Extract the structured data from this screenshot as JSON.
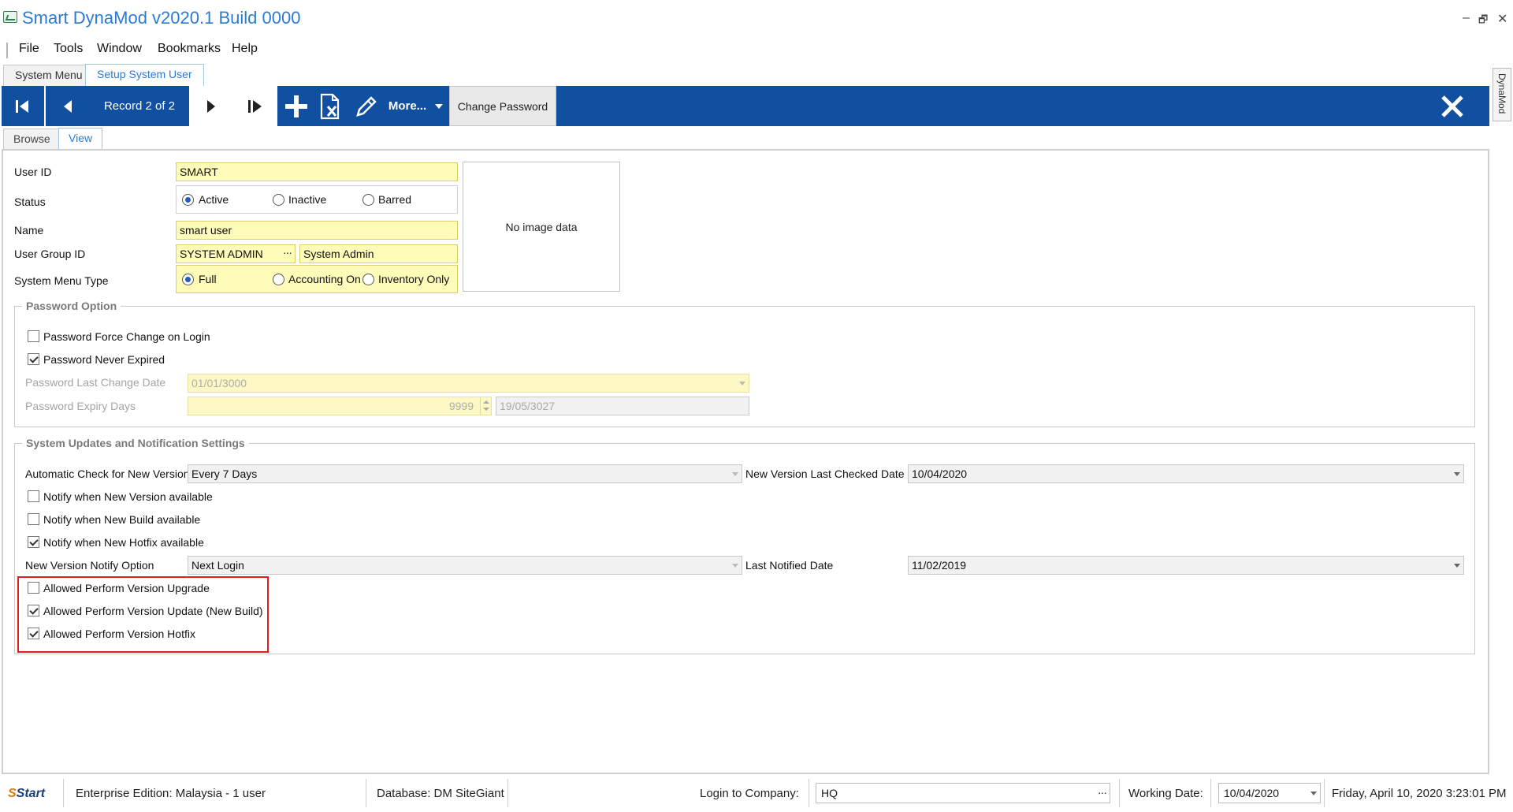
{
  "window": {
    "title": "Smart DynaMod v2020.1 Build 0000",
    "controls": [
      "–",
      "🗗",
      "✕"
    ]
  },
  "menu": [
    "File",
    "Tools",
    "Window",
    "Bookmarks",
    "Help"
  ],
  "doc_tabs": [
    "System Menu",
    "Setup System User"
  ],
  "toolbar": {
    "record_label": "Record 2 of 2",
    "more_label": "More...",
    "change_password_label": "Change Password",
    "side_tab_label": "DynaMod"
  },
  "view_tabs": [
    "Browse",
    "View"
  ],
  "form": {
    "user_id_label": "User ID",
    "user_id_value": "SMART",
    "status_label": "Status",
    "status_options": [
      "Active",
      "Inactive",
      "Barred"
    ],
    "status_selected": "Active",
    "name_label": "Name",
    "name_value": "smart user",
    "group_label": "User Group ID",
    "group_id_value": "SYSTEM ADMIN",
    "group_name_value": "System Admin",
    "menu_type_label": "System Menu Type",
    "menu_type_options": [
      "Full",
      "Accounting Only",
      "Inventory Only"
    ],
    "menu_type_selected": "Full",
    "image_placeholder": "No image data"
  },
  "password_option": {
    "title": "Password Option",
    "force_change_label": "Password Force Change on Login",
    "force_change_checked": false,
    "never_expired_label": "Password Never Expired",
    "never_expired_checked": true,
    "last_change_label": "Password Last Change Date",
    "last_change_value": "01/01/3000",
    "expiry_days_label": "Password Expiry Days",
    "expiry_days_value": "9999",
    "expiry_date_value": "19/05/3027"
  },
  "updates": {
    "title": "System Updates and Notification Settings",
    "auto_check_label": "Automatic Check for New Version",
    "auto_check_value": "Every 7 Days",
    "last_checked_label": "New Version Last Checked Date",
    "last_checked_value": "10/04/2020",
    "notify_version_label": "Notify when New Version available",
    "notify_version_checked": false,
    "notify_build_label": "Notify when New Build available",
    "notify_build_checked": false,
    "notify_hotfix_label": "Notify when New Hotfix available",
    "notify_hotfix_checked": true,
    "notify_option_label": "New Version Notify Option",
    "notify_option_value": "Next Login",
    "last_notified_label": "Last Notified Date",
    "last_notified_value": "11/02/2019",
    "allow_upgrade_label": "Allowed Perform Version Upgrade",
    "allow_upgrade_checked": false,
    "allow_update_label": "Allowed Perform Version Update (New Build)",
    "allow_update_checked": true,
    "allow_hotfix_label": "Allowed Perform Version Hotfix",
    "allow_hotfix_checked": true
  },
  "status_bar": {
    "start_label": "Start",
    "edition": "Enterprise Edition: Malaysia - 1 user",
    "database": "Database: DM SiteGiant",
    "login_company_label": "Login to Company:",
    "login_company_value": "HQ",
    "working_date_label": "Working Date:",
    "working_date_value": "10/04/2020",
    "datetime": "Friday, April 10, 2020 3:23:01 PM"
  },
  "colors": {
    "toolbar": "#114fa0",
    "title": "#2b7bd4",
    "field_yellow": "#fffbb8",
    "highlight": "#e02020"
  }
}
